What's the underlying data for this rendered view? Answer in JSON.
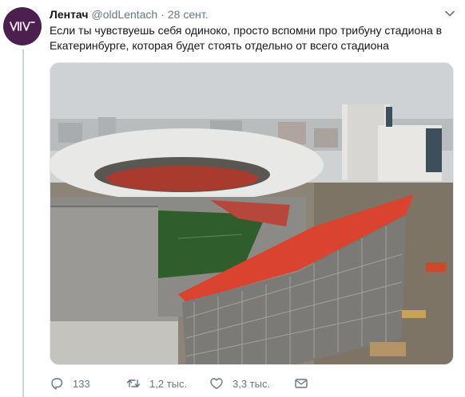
{
  "tweet": {
    "author_name": "Лентач",
    "author_handle": "@oldLentach",
    "separator": "·",
    "timestamp": "28 сент.",
    "text": "Если ты чувствуешь себя одиноко, просто вспомни про трибуну стадиона в Екатеринбурге, которая будет стоять отдельно от всего стадиона",
    "media_alt": "Stadium in Yekaterinburg with temporary stand outside the main arena"
  },
  "actions": {
    "replies": "133",
    "retweets": "1,2 тыс.",
    "likes": "3,3 тыс."
  },
  "colors": {
    "avatar_bg": "#4b1f4e",
    "text_primary": "#14171a",
    "text_secondary": "#657786",
    "thread_line": "#ccd6dd",
    "stand_red": "#d9432f"
  },
  "icons": [
    "lentach-logo-icon",
    "caret-down-icon",
    "reply-icon",
    "retweet-icon",
    "like-icon",
    "direct-message-icon"
  ]
}
